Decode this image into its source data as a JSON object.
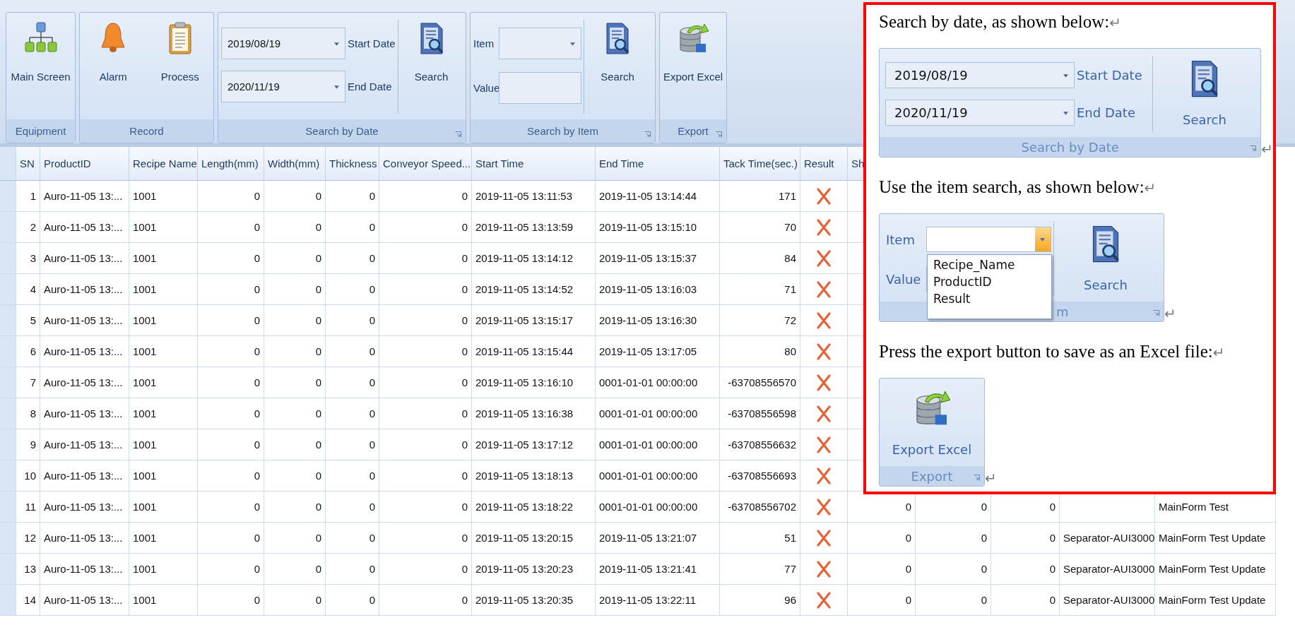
{
  "ribbon": {
    "groups": [
      {
        "kind": "nav",
        "label": "Equipment",
        "launcher": false,
        "buttons": [
          {
            "label": "Main Screen"
          }
        ]
      },
      {
        "kind": "record",
        "label": "Record",
        "launcher": false,
        "buttons": [
          {
            "label": "Alarm"
          },
          {
            "label": "Process"
          }
        ]
      },
      {
        "kind": "date",
        "label": "Search by Date",
        "launcher": true,
        "fields": [
          {
            "value": "2019/08/19",
            "label": "Start Date"
          },
          {
            "value": "2020/11/19",
            "label": "End Date"
          }
        ],
        "buttons": [
          {
            "label": "Search"
          }
        ]
      },
      {
        "kind": "item",
        "label": "Search by Item",
        "launcher": true,
        "fields": [
          {
            "label": "Item",
            "dropdown": true,
            "open": false
          },
          {
            "label": "Value",
            "dropdown": false
          }
        ],
        "buttons": [
          {
            "label": "Search"
          }
        ]
      },
      {
        "kind": "export",
        "label": "Export",
        "launcher": true,
        "buttons": [
          {
            "label": "Export Excel"
          }
        ]
      }
    ]
  },
  "table": {
    "columns": [
      "SN",
      "ProductID",
      "Recipe Name",
      "Length(mm)",
      "Width(mm)",
      "Thickness",
      "Conveyor Speed...",
      "Start Time",
      "End Time",
      "Tack Time(sec.)",
      "Result",
      "Sh"
    ],
    "rows": [
      {
        "cells": [
          "1",
          "Auro-11-05 13:...",
          "1001",
          "0",
          "0",
          "0",
          "0",
          "2019-11-05 13:11:53",
          "2019-11-05 13:14:44",
          "171"
        ],
        "failed": true
      },
      {
        "cells": [
          "2",
          "Auro-11-05 13:...",
          "1001",
          "0",
          "0",
          "0",
          "0",
          "2019-11-05 13:13:59",
          "2019-11-05 13:15:10",
          "70"
        ],
        "failed": true
      },
      {
        "cells": [
          "3",
          "Auro-11-05 13:...",
          "1001",
          "0",
          "0",
          "0",
          "0",
          "2019-11-05 13:14:12",
          "2019-11-05 13:15:37",
          "84"
        ],
        "failed": true
      },
      {
        "cells": [
          "4",
          "Auro-11-05 13:...",
          "1001",
          "0",
          "0",
          "0",
          "0",
          "2019-11-05 13:14:52",
          "2019-11-05 13:16:03",
          "71"
        ],
        "failed": true
      },
      {
        "cells": [
          "5",
          "Auro-11-05 13:...",
          "1001",
          "0",
          "0",
          "0",
          "0",
          "2019-11-05 13:15:17",
          "2019-11-05 13:16:30",
          "72"
        ],
        "failed": true
      },
      {
        "cells": [
          "6",
          "Auro-11-05 13:...",
          "1001",
          "0",
          "0",
          "0",
          "0",
          "2019-11-05 13:15:44",
          "2019-11-05 13:17:05",
          "80"
        ],
        "failed": true
      },
      {
        "cells": [
          "7",
          "Auro-11-05 13:...",
          "1001",
          "0",
          "0",
          "0",
          "0",
          "2019-11-05 13:16:10",
          "0001-01-01 00:00:00",
          "-63708556570"
        ],
        "failed": true
      },
      {
        "cells": [
          "8",
          "Auro-11-05 13:...",
          "1001",
          "0",
          "0",
          "0",
          "0",
          "2019-11-05 13:16:38",
          "0001-01-01 00:00:00",
          "-63708556598"
        ],
        "failed": true
      },
      {
        "cells": [
          "9",
          "Auro-11-05 13:...",
          "1001",
          "0",
          "0",
          "0",
          "0",
          "2019-11-05 13:17:12",
          "0001-01-01 00:00:00",
          "-63708556632"
        ],
        "failed": true
      },
      {
        "cells": [
          "10",
          "Auro-11-05 13:...",
          "1001",
          "0",
          "0",
          "0",
          "0",
          "2019-11-05 13:18:13",
          "0001-01-01 00:00:00",
          "-63708556693"
        ],
        "failed": true
      },
      {
        "cells": [
          "11",
          "Auro-11-05 13:...",
          "1001",
          "0",
          "0",
          "0",
          "0",
          "2019-11-05 13:18:22",
          "0001-01-01 00:00:00",
          "-63708556702"
        ],
        "failed": true,
        "extra": {
          "sh": "0",
          "column_13": "0",
          "column_14": "0",
          "column_16": "MainForm Test"
        }
      },
      {
        "cells": [
          "12",
          "Auro-11-05 13:...",
          "1001",
          "0",
          "0",
          "0",
          "0",
          "2019-11-05 13:20:15",
          "2019-11-05 13:21:07",
          "51"
        ],
        "failed": true,
        "extra": {
          "sh": "0",
          "column_13": "0",
          "column_14": "0",
          "column_15": "Separator-AUI3000",
          "column_16": "MainForm Test Update"
        }
      },
      {
        "cells": [
          "13",
          "Auro-11-05 13:...",
          "1001",
          "0",
          "0",
          "0",
          "0",
          "2019-11-05 13:20:23",
          "2019-11-05 13:21:41",
          "77"
        ],
        "failed": true,
        "extra": {
          "sh": "0",
          "column_13": "0",
          "column_14": "0",
          "column_15": "Separator-AUI3000",
          "column_16": "MainForm Test Update"
        }
      },
      {
        "cells": [
          "14",
          "Auro-11-05 13:...",
          "1001",
          "0",
          "0",
          "0",
          "0",
          "2019-11-05 13:20:35",
          "2019-11-05 13:22:11",
          "96"
        ],
        "failed": true,
        "extra": {
          "sh": "0",
          "column_13": "0",
          "column_14": "0",
          "column_15": "Separator-AUI3000",
          "column_16": "MainForm Test Update"
        }
      }
    ]
  },
  "document": {
    "blocks": [
      {
        "kind": "paragraph",
        "text": "Search by date, as shown below:",
        "mark": "↵"
      },
      {
        "kind": "group",
        "mark": "↵",
        "group": {
          "kind": "date",
          "label": "Search by Date",
          "launcher": true,
          "fields": [
            {
              "value": "2019/08/19",
              "label": "Start Date"
            },
            {
              "value": "2020/11/19",
              "label": "End Date"
            }
          ],
          "buttons": [
            {
              "label": "Search"
            }
          ]
        }
      },
      {
        "kind": "paragraph",
        "text": "Use the item search, as shown below:",
        "mark": "↵"
      },
      {
        "kind": "group",
        "mark": "↵",
        "group": {
          "kind": "item",
          "label": "m",
          "launcher": true,
          "fields": [
            {
              "label": "Item",
              "dropdown": true,
              "open": true,
              "options": [
                "Recipe_Name",
                "ProductID",
                "Result"
              ]
            },
            {
              "label": "Value",
              "dropdown": false
            }
          ],
          "buttons": [
            {
              "label": "Search"
            }
          ]
        }
      },
      {
        "kind": "paragraph",
        "text": "Press the export button to save as an Excel file:",
        "mark": "↵"
      },
      {
        "kind": "group",
        "mark": "↵",
        "group": {
          "kind": "export",
          "label": "Export",
          "launcher": true,
          "buttons": [
            {
              "label": "Export Excel"
            }
          ]
        }
      }
    ]
  }
}
